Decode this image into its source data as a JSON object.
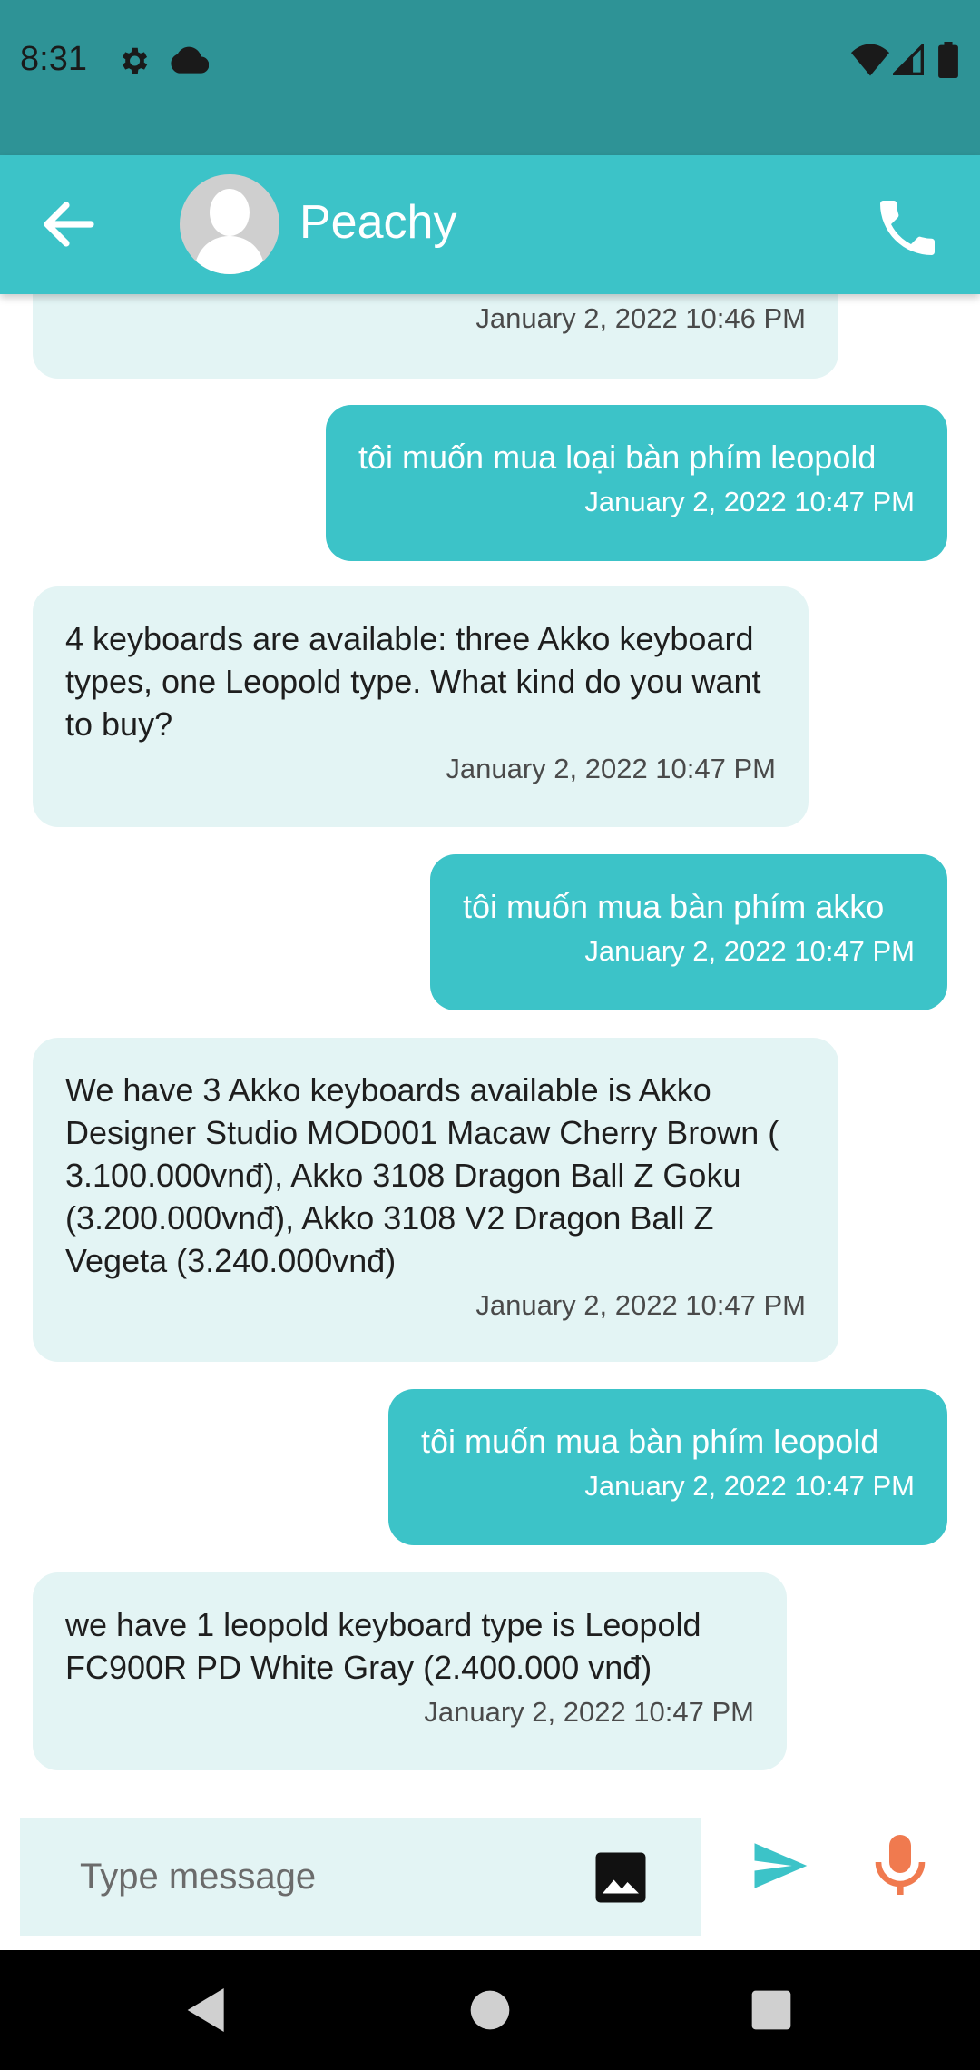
{
  "status_bar": {
    "time": "8:31",
    "icons": [
      "gear-icon",
      "cloud-icon",
      "wifi-icon",
      "signal-icon",
      "battery-icon"
    ]
  },
  "header": {
    "contact_name": "Peachy",
    "back_icon": "arrow-left-icon",
    "call_icon": "phone-icon"
  },
  "messages": [
    {
      "sender": "bot",
      "text": "",
      "time": "January 2, 2022 10:46 PM"
    },
    {
      "sender": "user",
      "text": "tôi muốn mua loại bàn phím leopold",
      "time": "January 2, 2022 10:47 PM"
    },
    {
      "sender": "bot",
      "text": "4 keyboards are available: three Akko keyboard types, one Leopold type. What kind do you want to buy?",
      "time": "January 2, 2022 10:47 PM"
    },
    {
      "sender": "user",
      "text": "tôi muốn mua bàn phím akko",
      "time": "January 2, 2022 10:47 PM"
    },
    {
      "sender": "bot",
      "text": "We have 3 Akko keyboards available is Akko Designer Studio MOD001 Macaw Cherry Brown ( 3.100.000vnđ), Akko 3108 Dragon Ball Z Goku (3.200.000vnđ), Akko 3108 V2 Dragon Ball Z Vegeta (3.240.000vnđ)",
      "time": "January 2, 2022 10:47 PM"
    },
    {
      "sender": "user",
      "text": "tôi muốn mua bàn phím leopold",
      "time": "January 2, 2022 10:47 PM"
    },
    {
      "sender": "bot",
      "text": "we have 1 leopold keyboard type is Leopold FC900R PD White Gray (2.400.000 vnđ)",
      "time": "January 2, 2022 10:47 PM"
    }
  ],
  "composer": {
    "placeholder": "Type message",
    "image_icon": "image-icon",
    "send_icon": "send-icon",
    "mic_icon": "mic-icon"
  },
  "nav_bar": {
    "icons": [
      "back-triangle-icon",
      "home-circle-icon",
      "recents-square-icon"
    ]
  },
  "colors": {
    "status_bar": "#2e9396",
    "app_bar": "#3cc3c8",
    "incoming_bubble": "#e3f4f4",
    "outgoing_bubble": "#3cc3c8",
    "mic": "#f07a4f"
  }
}
